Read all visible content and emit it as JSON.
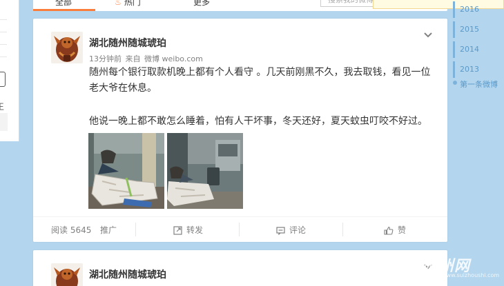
{
  "top_tabs": {
    "all": "全部",
    "hot": "热门",
    "more": "更多",
    "search_placeholder": "搜索我的微博"
  },
  "timeline": {
    "years": [
      "2016",
      "2015",
      "2014",
      "2013"
    ],
    "first_post": "第一条微博"
  },
  "left_panel": {
    "edge_char": "王"
  },
  "posts": [
    {
      "author": "湖北随州随城琥珀",
      "time": "13分钟前",
      "from_label": "来自",
      "source": "微博 weibo.com",
      "text_line1": "随州每个银行取款机晚上都有个人看守 。几天前刚黑不久，我去取钱，看见一位",
      "text_line2": "老大爷在休息。",
      "text_line3": "他说一晚上都不敢怎么睡着，怕有人干坏事，冬天还好，夏天蚊虫叮咬不好过。",
      "actions": {
        "read_label": "阅读",
        "read_count": "5645",
        "promote": "推广",
        "repost": "转发",
        "comment": "评论",
        "like": "赞"
      }
    },
    {
      "author": "湖北随州随城琥珀"
    }
  ],
  "watermark": {
    "main": "随州网",
    "sub": "www.suizhoushi.com"
  },
  "colors": {
    "accent": "#fa7d3c",
    "timeline": "#5b99c9",
    "page_bg": "#b3d6ee"
  }
}
